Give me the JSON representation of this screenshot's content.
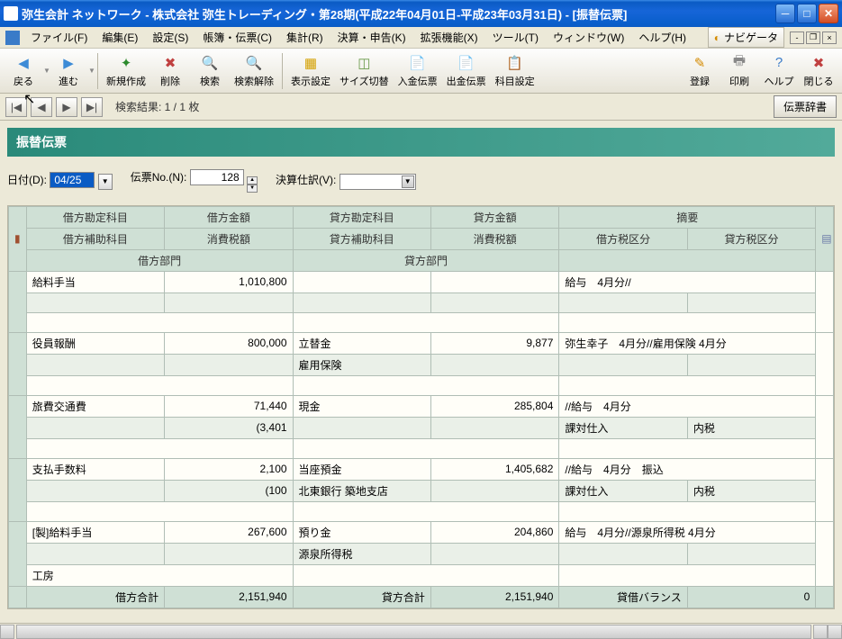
{
  "window": {
    "title": "弥生会計 ネットワーク - 株式会社 弥生トレーディング・第28期(平成22年04月01日-平成23年03月31日) - [振替伝票]"
  },
  "menu": {
    "items": [
      "ファイル(F)",
      "編集(E)",
      "設定(S)",
      "帳簿・伝票(C)",
      "集計(R)",
      "決算・申告(K)",
      "拡張機能(X)",
      "ツール(T)",
      "ウィンドウ(W)",
      "ヘルプ(H)"
    ],
    "navigator": "ナビゲータ"
  },
  "toolbar": {
    "back": "戻る",
    "forward": "進む",
    "new": "新規作成",
    "delete": "削除",
    "search": "検索",
    "clear_search": "検索解除",
    "display": "表示設定",
    "size": "サイズ切替",
    "receipt": "入金伝票",
    "payment": "出金伝票",
    "account": "科目設定",
    "register": "登録",
    "print": "印刷",
    "help": "ヘルプ",
    "close": "閉じる"
  },
  "search": {
    "result_label": "検索結果: 1 / 1 枚",
    "dict_button": "伝票辞書"
  },
  "header": {
    "title": "振替伝票"
  },
  "date_row": {
    "date_label": "日付(D):",
    "date_value": "04/25",
    "slip_label": "伝票No.(N):",
    "slip_value": "128",
    "closing_label": "決算仕訳(V):"
  },
  "grid": {
    "headers": {
      "debit_account": "借方勘定科目",
      "debit_amount": "借方金額",
      "credit_account": "貸方勘定科目",
      "credit_amount": "貸方金額",
      "abstract": "摘要",
      "debit_sub": "借方補助科目",
      "debit_tax_amt": "消費税額",
      "credit_sub": "貸方補助科目",
      "credit_tax_amt": "消費税額",
      "debit_tax_cls": "借方税区分",
      "credit_tax_cls": "貸方税区分",
      "debit_dept": "借方部門",
      "credit_dept": "貸方部門"
    },
    "rows": [
      {
        "d_acc": "給料手当",
        "d_amt": "1,010,800",
        "c_acc": "",
        "c_amt": "",
        "abs": "給与　4月分//",
        "d_sub": "",
        "d_tax_amt": "",
        "c_sub": "",
        "c_tax_amt": "",
        "d_tax": "",
        "c_tax": "",
        "d_dept": "",
        "c_dept": ""
      },
      {
        "d_acc": "役員報酬",
        "d_amt": "800,000",
        "c_acc": "立替金",
        "c_amt": "9,877",
        "abs": "弥生幸子　4月分//雇用保険 4月分",
        "d_sub": "",
        "d_tax_amt": "",
        "c_sub": "雇用保険",
        "c_tax_amt": "",
        "d_tax": "",
        "c_tax": "",
        "d_dept": "",
        "c_dept": ""
      },
      {
        "d_acc": "旅費交通費",
        "d_amt": "71,440",
        "c_acc": "現金",
        "c_amt": "285,804",
        "abs": "//給与　4月分",
        "d_sub": "",
        "d_tax_amt": "(3,401",
        "c_sub": "",
        "c_tax_amt": "",
        "d_tax": "課対仕入",
        "c_tax": "内税",
        "d_dept": "",
        "c_dept": ""
      },
      {
        "d_acc": "支払手数料",
        "d_amt": "2,100",
        "c_acc": "当座預金",
        "c_amt": "1,405,682",
        "abs": "//給与　4月分　振込",
        "d_sub": "",
        "d_tax_amt": "(100",
        "c_sub": "北東銀行 築地支店",
        "c_tax_amt": "",
        "d_tax": "課対仕入",
        "c_tax": "内税",
        "d_dept": "",
        "c_dept": ""
      },
      {
        "d_acc": "[製]給料手当",
        "d_amt": "267,600",
        "c_acc": "預り金",
        "c_amt": "204,860",
        "abs": "給与　4月分//源泉所得税 4月分",
        "d_sub": "",
        "d_tax_amt": "",
        "c_sub": "源泉所得税",
        "c_tax_amt": "",
        "d_tax": "",
        "c_tax": "",
        "d_dept": "工房",
        "c_dept": ""
      }
    ],
    "totals": {
      "debit_label": "借方合計",
      "debit_val": "2,151,940",
      "credit_label": "貸方合計",
      "credit_val": "2,151,940",
      "balance_label": "貸借バランス",
      "balance_val": "0"
    }
  }
}
